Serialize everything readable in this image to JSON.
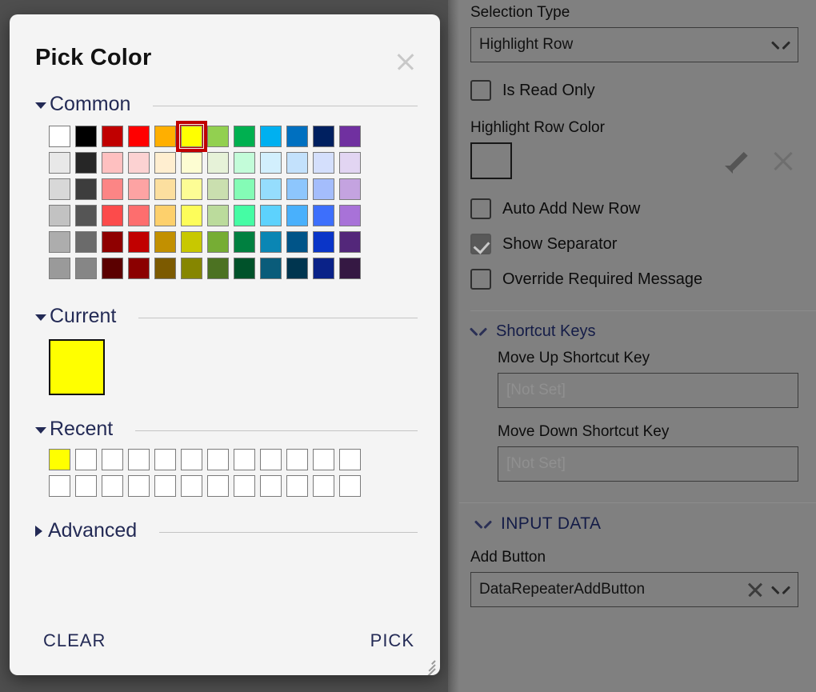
{
  "dialog": {
    "title": "Pick Color",
    "close_icon": "close-icon",
    "sections": {
      "common": {
        "label": "Common",
        "expanded": true
      },
      "current": {
        "label": "Current",
        "expanded": true
      },
      "recent": {
        "label": "Recent",
        "expanded": true
      },
      "advanced": {
        "label": "Advanced",
        "expanded": false
      }
    },
    "footer": {
      "clear_label": "CLEAR",
      "pick_label": "PICK"
    },
    "selected_color": "#ffff00",
    "current_color": "#ffff00",
    "selection_outline_color": "#c00000",
    "common_palette": [
      [
        "#ffffff",
        "#000000",
        "#c00000",
        "#ff0000",
        "#ffaf00",
        "#ffff00",
        "#92d050",
        "#00b050",
        "#00b0f0",
        "#0070c0",
        "#002060",
        "#7030a0"
      ],
      [
        "#e8e8e8",
        "#262626",
        "#fec0c0",
        "#fcd2d2",
        "#ffeed0",
        "#fdfdd2",
        "#e6f2d8",
        "#c3fcd9",
        "#d2effd",
        "#c3e1fc",
        "#d4dffc",
        "#e2d5f2"
      ],
      [
        "#d8d8d8",
        "#3d3d3d",
        "#fc8585",
        "#fda3a3",
        "#fcdf9f",
        "#fdfd95",
        "#cadfaf",
        "#84fcb6",
        "#95ddfd",
        "#8dc6fd",
        "#a4bdfc",
        "#c4a3e0"
      ],
      [
        "#c2c2c2",
        "#555555",
        "#fc4b4b",
        "#fd6e6e",
        "#fdd06c",
        "#fdfd5a",
        "#bbdb9c",
        "#45fca4",
        "#5dd2fd",
        "#49b0fc",
        "#3d6ffc",
        "#a872d8"
      ],
      [
        "#adadad",
        "#6b6b6b",
        "#8f0000",
        "#c10000",
        "#c29000",
        "#c8c800",
        "#76ad34",
        "#008040",
        "#0a86b4",
        "#005488",
        "#0a35c8",
        "#53277a"
      ],
      [
        "#9a9a9a",
        "#868686",
        "#5b0000",
        "#8b0000",
        "#7c5a00",
        "#868600",
        "#4c7222",
        "#00522a",
        "#0a5c7a",
        "#00354f",
        "#0a2288",
        "#351843"
      ]
    ],
    "recent_swatches": [
      "#ffff00",
      "#ffffff",
      "#ffffff",
      "#ffffff",
      "#ffffff",
      "#ffffff",
      "#ffffff",
      "#ffffff",
      "#ffffff",
      "#ffffff",
      "#ffffff",
      "#ffffff",
      "#ffffff",
      "#ffffff",
      "#ffffff",
      "#ffffff",
      "#ffffff",
      "#ffffff",
      "#ffffff",
      "#ffffff",
      "#ffffff",
      "#ffffff",
      "#ffffff",
      "#ffffff"
    ]
  },
  "properties_panel": {
    "selection_type": {
      "label": "Selection Type",
      "value": "Highlight Row",
      "chevron_icon": "chevron-down-icon"
    },
    "is_read_only": {
      "label": "Is Read Only",
      "checked": false
    },
    "highlight_row_color": {
      "label": "Highlight Row Color",
      "value": "",
      "edit_icon": "pencil-icon",
      "clear_icon": "close-icon"
    },
    "auto_add_new_row": {
      "label": "Auto Add New Row",
      "checked": false
    },
    "show_separator": {
      "label": "Show Separator",
      "checked": true
    },
    "override_required_message": {
      "label": "Override Required Message",
      "checked": false
    },
    "shortcut_keys": {
      "label": "Shortcut Keys",
      "expanded": true,
      "chevron_icon": "chevron-down-icon",
      "move_up": {
        "label": "Move Up Shortcut Key",
        "placeholder": "[Not Set]",
        "value": ""
      },
      "move_down": {
        "label": "Move Down Shortcut Key",
        "placeholder": "[Not Set]",
        "value": ""
      }
    },
    "input_data": {
      "label": "INPUT DATA",
      "expanded": true,
      "chevron_icon": "chevron-down-icon",
      "add_button": {
        "label": "Add Button",
        "value": "DataRepeaterAddButton",
        "clear_icon": "close-icon",
        "chevron_icon": "chevron-down-icon"
      }
    }
  }
}
